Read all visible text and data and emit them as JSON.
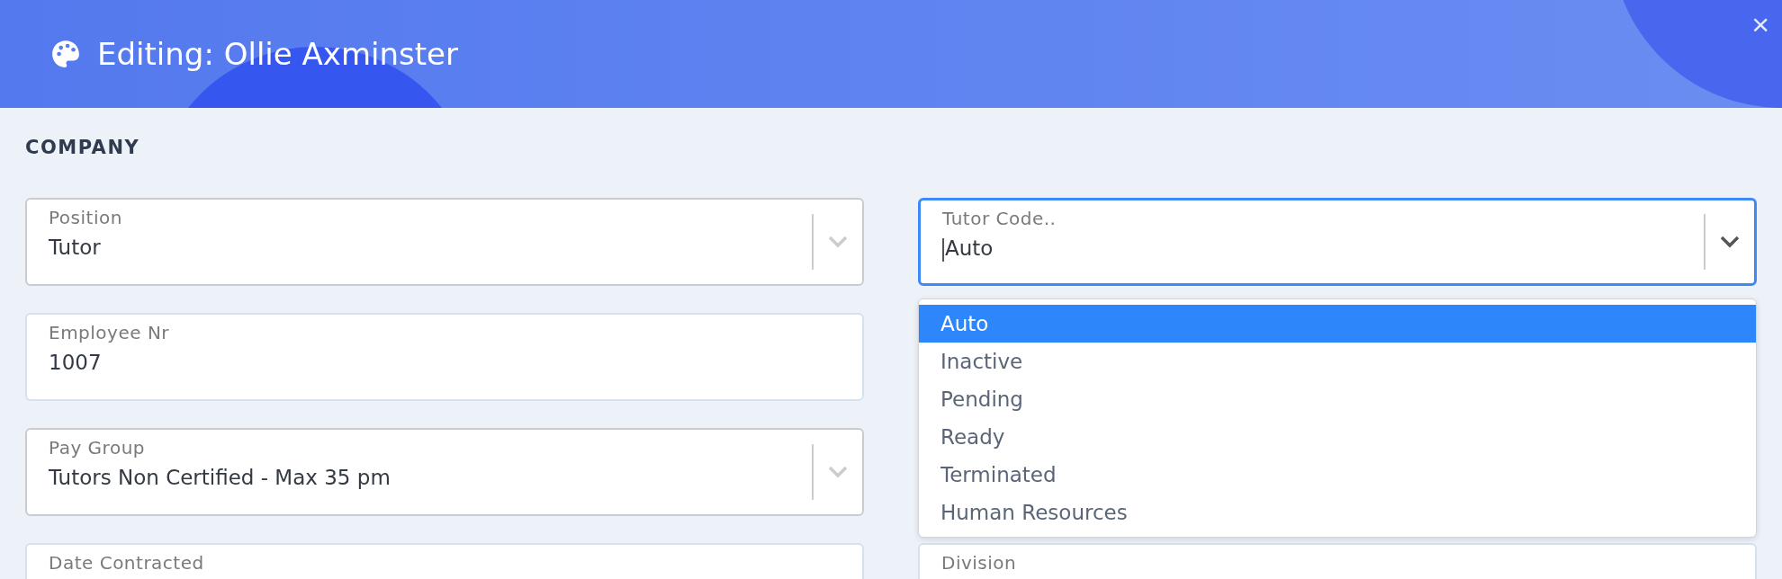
{
  "header": {
    "title": "Editing: Ollie Axminster",
    "close": "×"
  },
  "section": {
    "title": "COMPANY"
  },
  "left_fields": [
    {
      "kind": "select",
      "label": "Position",
      "value": "Tutor",
      "focused": false
    },
    {
      "kind": "text",
      "label": "Employee Nr",
      "value": "1007",
      "focused": false
    },
    {
      "kind": "select",
      "label": "Pay Group",
      "value": "Tutors Non Certified - Max 35 pm",
      "focused": false
    },
    {
      "kind": "text",
      "label": "Date Contracted",
      "focused": false
    }
  ],
  "right_fields": [
    {
      "kind": "select",
      "label": "Tutor Code..",
      "value": "Auto",
      "focused": true,
      "expanded": true,
      "options": [
        {
          "label": "Auto",
          "selected": true
        },
        {
          "label": "Inactive",
          "selected": false
        },
        {
          "label": "Pending",
          "selected": false
        },
        {
          "label": "Ready",
          "selected": false
        },
        {
          "label": "Terminated",
          "selected": false
        },
        {
          "label": "Human Resources",
          "selected": false
        }
      ]
    },
    {
      "kind": "spacer"
    },
    {
      "kind": "spacer"
    },
    {
      "kind": "text",
      "label": "Division",
      "focused": false
    }
  ]
}
